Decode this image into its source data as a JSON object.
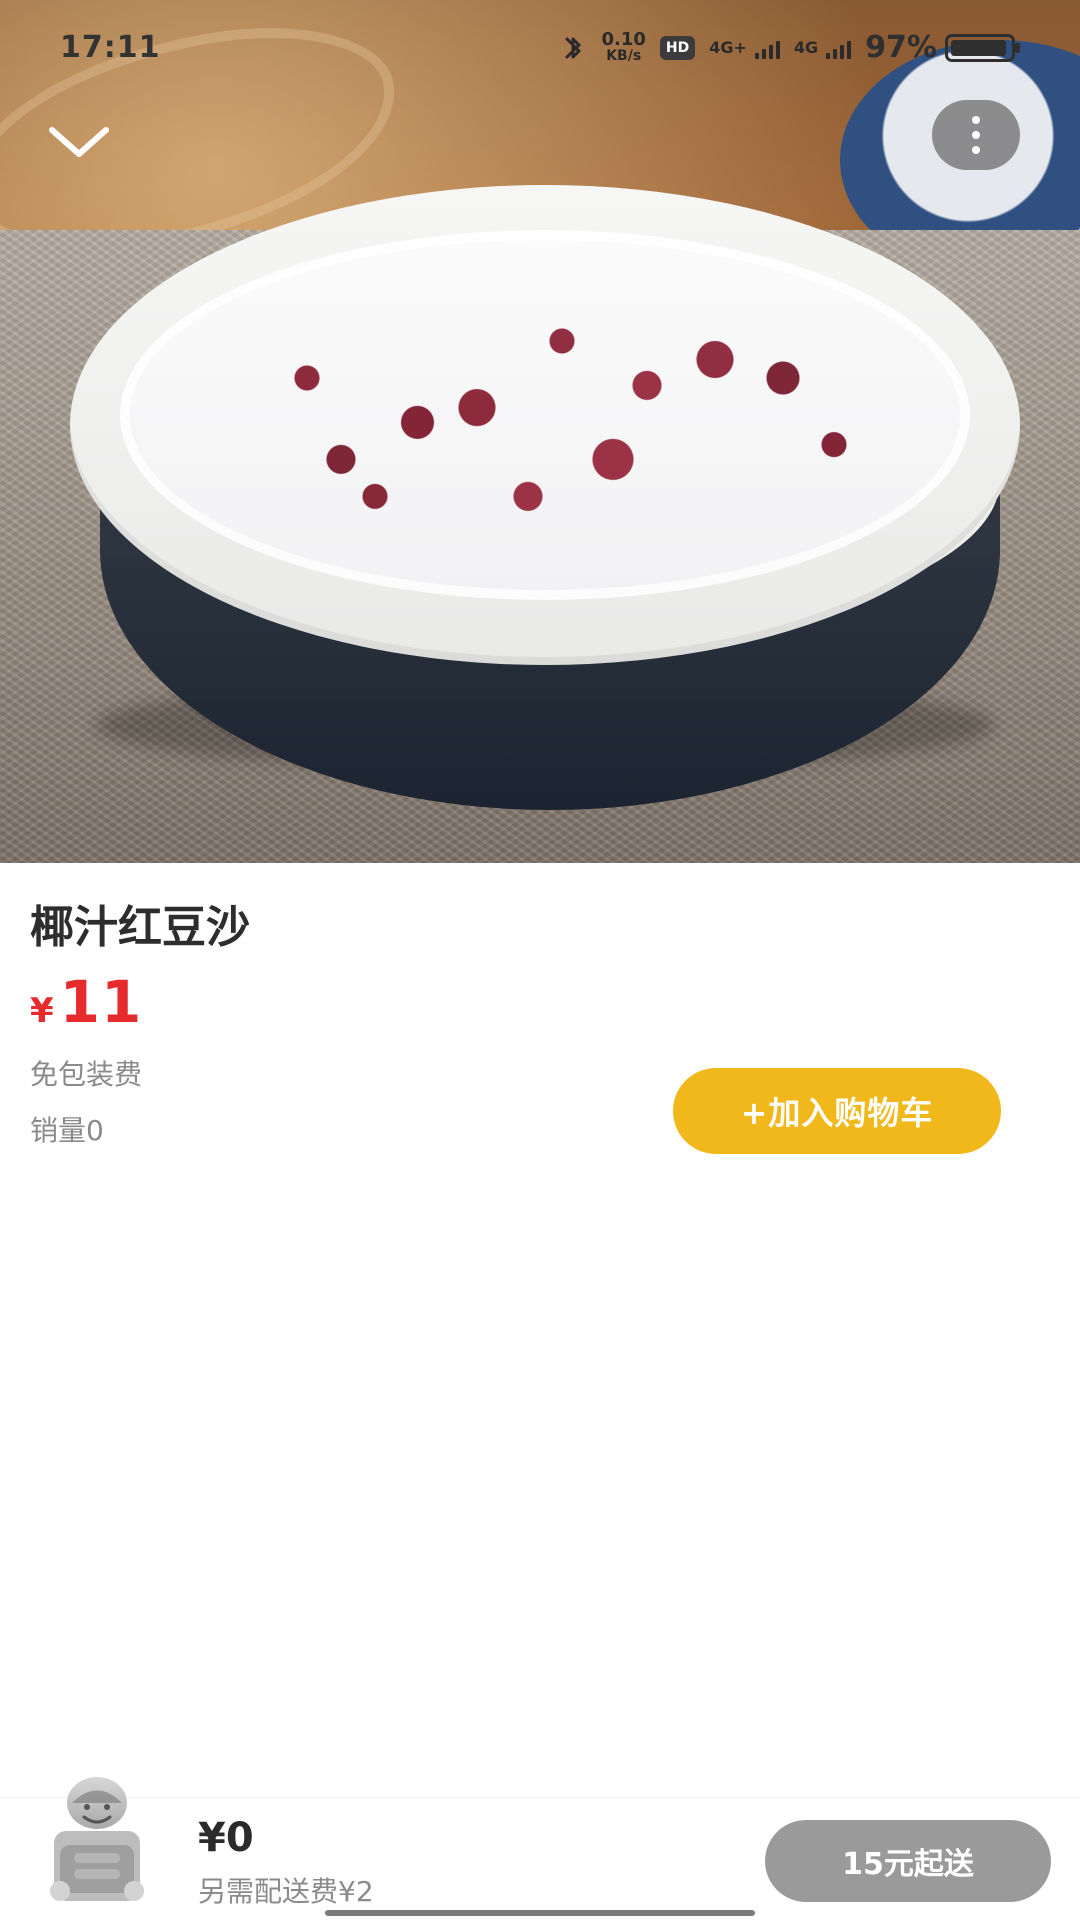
{
  "status_bar": {
    "time": "17:11",
    "network_speed_value": "0.10",
    "network_speed_unit": "KB/s",
    "hd_label": "HD",
    "network_1": "4G+",
    "network_2": "4G",
    "battery_percent": "97%"
  },
  "product": {
    "name": "椰汁红豆沙",
    "currency_symbol": "¥",
    "price": "11",
    "packing_fee_note": "免包装费",
    "sales_label": "销量0"
  },
  "actions": {
    "add_to_cart_label": "+加入购物车"
  },
  "cart_bar": {
    "total": "¥0",
    "delivery_fee_note": "另需配送费¥2",
    "min_order_label": "15元起送"
  },
  "colors": {
    "price_red": "#e52b2b",
    "add_to_cart_yellow": "#f1b81b",
    "min_order_gray": "#9a9a9a"
  },
  "icons": {
    "back": "chevron-down-icon",
    "more": "more-vertical-icon",
    "bluetooth": "bluetooth-icon",
    "battery": "battery-icon",
    "mascot": "mascot-icon"
  }
}
